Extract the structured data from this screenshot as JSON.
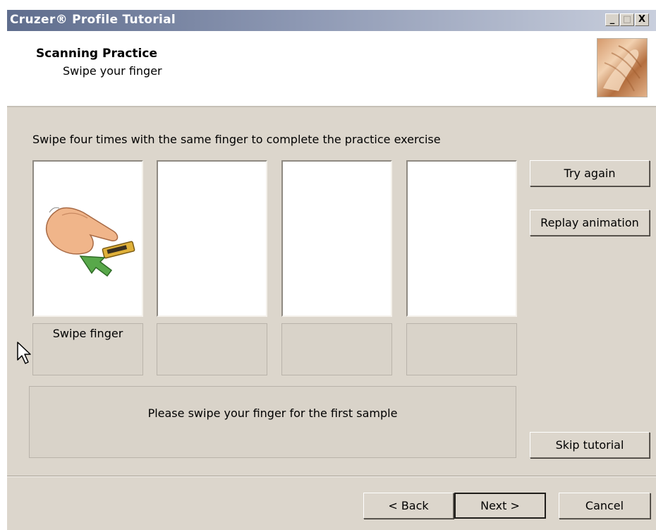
{
  "window": {
    "title": "Cruzer® Profile Tutorial",
    "controls": {
      "minimize": "_",
      "maximize": "□",
      "close": "X"
    }
  },
  "header": {
    "title": "Scanning Practice",
    "subtitle": "Swipe your finger",
    "image_icon": "fingerprint-photo"
  },
  "main": {
    "instruction": "Swipe four times with the same finger to complete the practice exercise",
    "samples": [
      {
        "label": "Swipe finger",
        "icon": "finger-swipe-icon"
      },
      {
        "label": ""
      },
      {
        "label": ""
      },
      {
        "label": ""
      }
    ],
    "status": "Please swipe your finger for the first sample"
  },
  "side_buttons": {
    "try_again": "Try again",
    "replay": "Replay animation",
    "skip": "Skip tutorial"
  },
  "footer": {
    "back": "< Back",
    "next": "Next >",
    "cancel": "Cancel"
  },
  "colors": {
    "dialog_bg": "#dcd6cc",
    "titlebar_start": "#5f6d8d",
    "titlebar_end": "#c9cfdd",
    "sensor_gold": "#e0b13a",
    "arrow_green": "#58a84a"
  }
}
